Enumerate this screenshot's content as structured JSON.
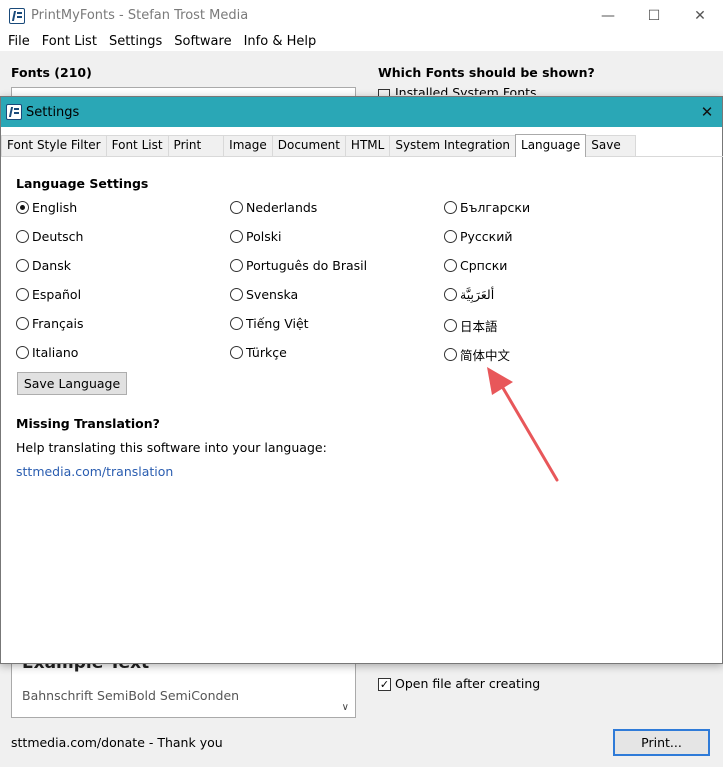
{
  "main": {
    "title": "PrintMyFonts - Stefan Trost Media",
    "menu": [
      "File",
      "Font List",
      "Settings",
      "Software",
      "Info & Help"
    ],
    "fonts_label": "Fonts (210)",
    "which_label": "Which Fonts should be shown?",
    "installed_label": "Installed System Fonts",
    "preview_title": "Example Text",
    "preview_sub": "Bahnschrift SemiBold SemiConden",
    "open_file_label": "Open file after creating",
    "donate_text": "sttmedia.com/donate - Thank you",
    "print_label": "Print..."
  },
  "dialog": {
    "title": "Settings",
    "tabs": [
      "Font Style Filter",
      "Font List",
      "Print",
      "Image",
      "Document",
      "HTML",
      "System Integration",
      "Language",
      "Save"
    ],
    "active_tab": "Language",
    "language_settings_title": "Language Settings",
    "languages": {
      "col1": [
        "English",
        "Deutsch",
        "Dansk",
        "Español",
        "Français",
        "Italiano"
      ],
      "col2": [
        "Nederlands",
        "Polski",
        "Português do Brasil",
        "Svenska",
        "Tiếng Việt",
        "Türkçe"
      ],
      "col3": [
        "Български",
        "Русский",
        "Српски",
        "ألعَرَبِيَّة",
        "日本語",
        "简体中文"
      ]
    },
    "selected_language": "English",
    "save_language_label": "Save Language",
    "missing_title": "Missing Translation?",
    "help_text": "Help translating this software into your language:",
    "link_text": "sttmedia.com/translation"
  },
  "colors": {
    "dialog_title_bar": "#2aa7b6",
    "link": "#2a5db0",
    "arrow": "#e8575a"
  }
}
